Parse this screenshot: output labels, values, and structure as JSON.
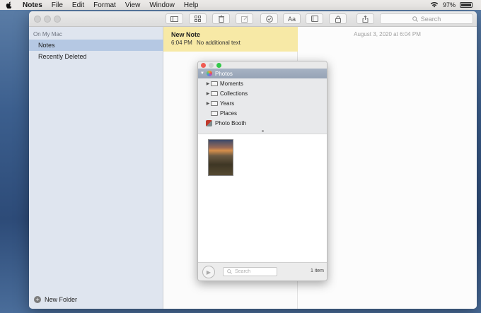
{
  "menubar": {
    "app": "Notes",
    "items": [
      "File",
      "Edit",
      "Format",
      "View",
      "Window",
      "Help"
    ],
    "battery": "97%",
    "battery_level": 0.97
  },
  "toolbar": {
    "search_placeholder": "Search",
    "buttons": [
      "sidebar-toggle-icon",
      "grid-icon",
      "trash-icon",
      "compose-icon",
      "checklist-icon",
      "text-format-icon",
      "table-icon",
      "lock-icon",
      "share-icon"
    ]
  },
  "sidebar": {
    "section": "On My Mac",
    "items": [
      {
        "label": "Notes",
        "selected": true
      },
      {
        "label": "Recently Deleted",
        "selected": false
      }
    ],
    "new_folder": "New Folder"
  },
  "notes": [
    {
      "title": "New Note",
      "time": "6:04 PM",
      "preview": "No additional text"
    }
  ],
  "editor": {
    "date": "August 3, 2020 at 6:04 PM"
  },
  "photos": {
    "tree": [
      {
        "label": "Photos",
        "selected": true,
        "expanded": true
      },
      {
        "label": "Moments",
        "indent": 1
      },
      {
        "label": "Collections",
        "indent": 1
      },
      {
        "label": "Years",
        "indent": 1
      },
      {
        "label": "Places",
        "indent": 1
      },
      {
        "label": "Photo Booth",
        "indent": 0
      }
    ],
    "search_placeholder": "Search",
    "count": "1 item"
  }
}
